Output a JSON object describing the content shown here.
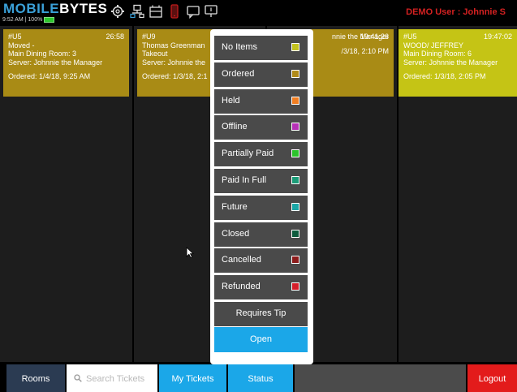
{
  "app": {
    "logo_part1": "MOBILE",
    "logo_part2": "BYTES",
    "status_time": "9:52 AM",
    "status_battery": "100%",
    "demo_user": "DEMO User : Johnnie S"
  },
  "toolbar_icons": [
    "gear-icon",
    "network-icon",
    "cash-drawer-icon",
    "phone-icon",
    "chat-icon",
    "message-icon"
  ],
  "tickets": [
    {
      "number": "#U5",
      "time": "26:58",
      "line1": "Moved -",
      "line2": "Main Dining Room: 3",
      "line3": "Server: Johnnie the Manager",
      "ordered": "Ordered: 1/4/18, 9:25 AM",
      "color": "#a98b15"
    },
    {
      "number": "#U9",
      "time": "",
      "line1": "Thomas Greenman",
      "line2": "Takeout",
      "line3": "Server: Johnnie the",
      "ordered": "Ordered: 1/3/18, 2:1",
      "color": "#a98b15"
    },
    {
      "number": "",
      "time": "19:41:26",
      "line1": "",
      "line2": "",
      "line3": "nnie the Manager",
      "ordered": "/3/18, 2:10 PM",
      "color": "#a98b15"
    },
    {
      "number": "#U5",
      "time": "19:47:02",
      "line1": "WOOD/ JEFFREY",
      "line2": "Main Dining Room: 6",
      "line3": "Server: Johnnie the Manager",
      "ordered": "Ordered: 1/3/18, 2:05 PM",
      "color": "#c5c415"
    }
  ],
  "status_menu": {
    "items": [
      {
        "label": "No Items",
        "color": "#c3c21f"
      },
      {
        "label": "Ordered",
        "color": "#b08a1a"
      },
      {
        "label": "Held",
        "color": "#f07e22"
      },
      {
        "label": "Offline",
        "color": "#b530b5"
      },
      {
        "label": "Partially Paid",
        "color": "#2bc42b"
      },
      {
        "label": "Paid In Full",
        "color": "#1c9c78"
      },
      {
        "label": "Future",
        "color": "#1aa6a6"
      },
      {
        "label": "Closed",
        "color": "#0f5c3e"
      },
      {
        "label": "Cancelled",
        "color": "#8c1b1b"
      },
      {
        "label": "Refunded",
        "color": "#d41e2a"
      }
    ],
    "requires_tip": "Requires Tip",
    "open": "Open"
  },
  "bottom_bar": {
    "rooms": "Rooms",
    "search_placeholder": "Search Tickets",
    "my_tickets": "My Tickets",
    "status": "Status",
    "logout": "Logout"
  }
}
